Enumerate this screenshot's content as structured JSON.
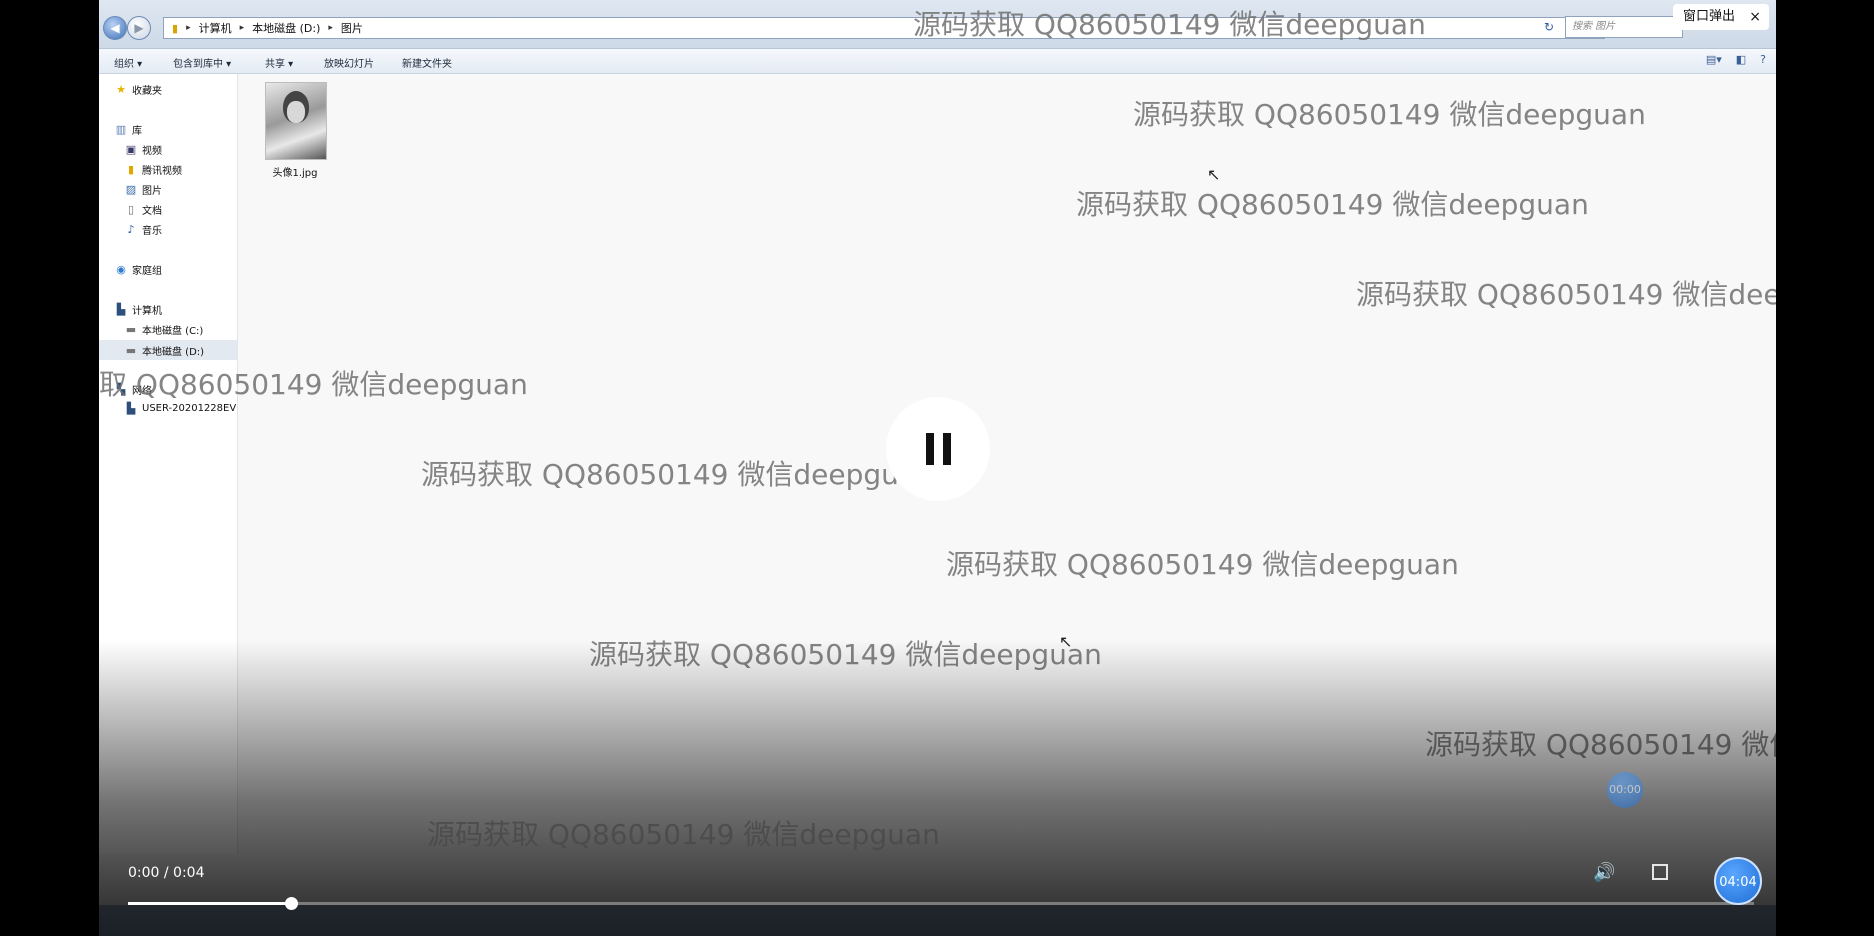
{
  "explorer": {
    "breadcrumb": [
      "计算机",
      "本地磁盘 (D:)",
      "图片"
    ],
    "search_placeholder": "搜索 图片",
    "toolbar": {
      "organize": "组织 ▾",
      "include_in_library": "包含到库中 ▾",
      "share": "共享 ▾",
      "slideshow": "放映幻灯片",
      "new_folder": "新建文件夹"
    },
    "nav": {
      "favorites": "收藏夹",
      "libraries": "库",
      "videos": "视频",
      "tencent_video": "腾讯视频",
      "pictures": "图片",
      "documents": "文档",
      "music": "音乐",
      "homegroup": "家庭组",
      "computer": "计算机",
      "drive_c": "本地磁盘 (C:)",
      "drive_d": "本地磁盘 (D:)",
      "network": "网络",
      "network_pc": "USER-20201228EV"
    },
    "file": {
      "name": "头像1.jpg"
    }
  },
  "popout": {
    "label": "窗口弹出",
    "close": "×"
  },
  "watermark": {
    "text": "源码获取 QQ86050149 微信deepguan",
    "fragment": "取 QQ86050149 微信deepguan"
  },
  "player": {
    "time": "0:00 / 0:04",
    "progress_fraction": 0.1,
    "bubble_small": "00:00",
    "bubble_big": "04:04",
    "accent": "#1e6fd6"
  }
}
